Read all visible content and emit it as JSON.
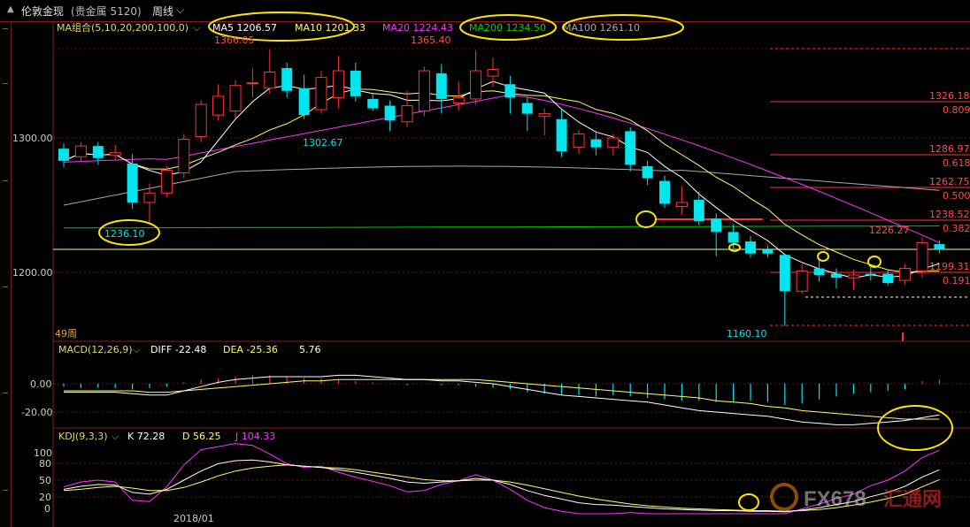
{
  "header": {
    "collapse_glyph": "▲",
    "symbol_name": "伦敦金现",
    "symbol_market": "(贵金属 5120)",
    "period": "周线",
    "dropdown_glyph": "⌵"
  },
  "colors": {
    "up": "#ff3333",
    "down": "#00e5ee",
    "ma5": "#ffffff",
    "ma10": "#ffff66",
    "ma20": "#ff33ff",
    "ma100": "#aaaaaa",
    "ma200": "#00cc00",
    "highlight_ellipse": "#ffe600",
    "grid": "#7a1414",
    "fib_label": "#ff4d4d",
    "last_price_line": "#ffff88"
  },
  "main_panel": {
    "legend_prefix": "MA组合(5,10,20,200,100,0)",
    "ma_legend": [
      {
        "label": "MA5 1206.57",
        "color": "#ffffff"
      },
      {
        "label": "MA10 1201.33",
        "color": "#ffff66"
      },
      {
        "label": "MA20 1224.43",
        "color": "#ff33ff"
      },
      {
        "label": "MA200 1234.50",
        "color": "#00dd00"
      },
      {
        "label": "MA100 1261.10",
        "color": "#aaaaaa"
      }
    ],
    "y_ticks": [
      "1300.00",
      "1200.00"
    ],
    "y_tick_values": [
      1300,
      1200
    ],
    "annotations": {
      "high_1": "1366.05",
      "high_2": "1365.40",
      "mid_low": "1302.67",
      "low_1": "1236.10",
      "low_2": "1160.10",
      "last_high": "1226.27"
    },
    "bars_count_label": "49周",
    "fib_levels": [
      {
        "price": "1326.18",
        "ratio": "0.809"
      },
      {
        "price": "1286.97",
        "ratio": "0.618"
      },
      {
        "price": "1262.75",
        "ratio": "0.500"
      },
      {
        "price": "1238.52",
        "ratio": "0.382"
      },
      {
        "price": "1199.31",
        "ratio": "0.191"
      }
    ]
  },
  "macd_panel": {
    "title": "MACD(12,26,9)",
    "diff": "DIFF -22.48",
    "dea": "DEA -25.36",
    "macd": "5.76",
    "y_ticks": [
      "0.00",
      "-20.00"
    ]
  },
  "kdj_panel": {
    "title": "KDJ(9,3,3)",
    "k": "K 72.28",
    "d": "D 56.25",
    "j": "J 104.33",
    "y_ticks": [
      "100",
      "80",
      "50",
      "20",
      "0"
    ],
    "x_label": "2018/01"
  },
  "watermark": {
    "brand": "FX678",
    "cn": "汇通网"
  },
  "chart_data": {
    "type": "candlestick",
    "period": "weekly",
    "ylim": [
      1160,
      1370
    ],
    "candles": [
      {
        "o": 1292,
        "c": 1283,
        "h": 1296,
        "l": 1278
      },
      {
        "o": 1286,
        "c": 1294,
        "h": 1297,
        "l": 1282
      },
      {
        "o": 1294,
        "c": 1285,
        "h": 1297,
        "l": 1280
      },
      {
        "o": 1287,
        "c": 1289,
        "h": 1295,
        "l": 1283
      },
      {
        "o": 1281,
        "c": 1252,
        "h": 1288,
        "l": 1247
      },
      {
        "o": 1252,
        "c": 1259,
        "h": 1266,
        "l": 1236
      },
      {
        "o": 1259,
        "c": 1276,
        "h": 1279,
        "l": 1256
      },
      {
        "o": 1274,
        "c": 1299,
        "h": 1303,
        "l": 1270
      },
      {
        "o": 1301,
        "c": 1325,
        "h": 1328,
        "l": 1297
      },
      {
        "o": 1317,
        "c": 1331,
        "h": 1340,
        "l": 1313
      },
      {
        "o": 1320,
        "c": 1339,
        "h": 1343,
        "l": 1315
      },
      {
        "o": 1341,
        "c": 1341,
        "h": 1352,
        "l": 1330
      },
      {
        "o": 1337,
        "c": 1349,
        "h": 1366,
        "l": 1333
      },
      {
        "o": 1352,
        "c": 1335,
        "h": 1356,
        "l": 1330
      },
      {
        "o": 1337,
        "c": 1317,
        "h": 1347,
        "l": 1314
      },
      {
        "o": 1321,
        "c": 1345,
        "h": 1350,
        "l": 1318
      },
      {
        "o": 1330,
        "c": 1350,
        "h": 1361,
        "l": 1322
      },
      {
        "o": 1350,
        "c": 1331,
        "h": 1356,
        "l": 1327
      },
      {
        "o": 1329,
        "c": 1322,
        "h": 1333,
        "l": 1320
      },
      {
        "o": 1324,
        "c": 1313,
        "h": 1328,
        "l": 1305
      },
      {
        "o": 1312,
        "c": 1324,
        "h": 1335,
        "l": 1308
      },
      {
        "o": 1320,
        "c": 1350,
        "h": 1353,
        "l": 1316
      },
      {
        "o": 1348,
        "c": 1329,
        "h": 1355,
        "l": 1318
      },
      {
        "o": 1326,
        "c": 1330,
        "h": 1342,
        "l": 1320
      },
      {
        "o": 1329,
        "c": 1350,
        "h": 1365,
        "l": 1325
      },
      {
        "o": 1346,
        "c": 1351,
        "h": 1360,
        "l": 1338
      },
      {
        "o": 1340,
        "c": 1330,
        "h": 1346,
        "l": 1318
      },
      {
        "o": 1326,
        "c": 1318,
        "h": 1330,
        "l": 1305
      },
      {
        "o": 1316,
        "c": 1318,
        "h": 1322,
        "l": 1302
      },
      {
        "o": 1314,
        "c": 1290,
        "h": 1321,
        "l": 1286
      },
      {
        "o": 1293,
        "c": 1303,
        "h": 1306,
        "l": 1288
      },
      {
        "o": 1299,
        "c": 1293,
        "h": 1305,
        "l": 1287
      },
      {
        "o": 1293,
        "c": 1300,
        "h": 1303,
        "l": 1287
      },
      {
        "o": 1305,
        "c": 1280,
        "h": 1308,
        "l": 1275
      },
      {
        "o": 1279,
        "c": 1270,
        "h": 1283,
        "l": 1265
      },
      {
        "o": 1268,
        "c": 1251,
        "h": 1272,
        "l": 1248
      },
      {
        "o": 1249,
        "c": 1252,
        "h": 1264,
        "l": 1243
      },
      {
        "o": 1254,
        "c": 1238,
        "h": 1260,
        "l": 1235
      },
      {
        "o": 1240,
        "c": 1230,
        "h": 1244,
        "l": 1212
      },
      {
        "o": 1230,
        "c": 1222,
        "h": 1236,
        "l": 1218
      },
      {
        "o": 1223,
        "c": 1214,
        "h": 1227,
        "l": 1211
      },
      {
        "o": 1217,
        "c": 1214,
        "h": 1220,
        "l": 1211
      },
      {
        "o": 1213,
        "c": 1186,
        "h": 1214,
        "l": 1160
      },
      {
        "o": 1186,
        "c": 1201,
        "h": 1206,
        "l": 1184
      },
      {
        "o": 1203,
        "c": 1198,
        "h": 1210,
        "l": 1193
      },
      {
        "o": 1199,
        "c": 1196,
        "h": 1203,
        "l": 1188
      },
      {
        "o": 1196,
        "c": 1198,
        "h": 1202,
        "l": 1187
      },
      {
        "o": 1199,
        "c": 1198,
        "h": 1204,
        "l": 1194
      },
      {
        "o": 1199,
        "c": 1192,
        "h": 1202,
        "l": 1190
      },
      {
        "o": 1194,
        "c": 1203,
        "h": 1206,
        "l": 1191
      },
      {
        "o": 1201,
        "c": 1222,
        "h": 1226,
        "l": 1196
      },
      {
        "o": 1221,
        "c": 1217,
        "h": 1224,
        "l": 1214
      }
    ],
    "macd": {
      "ylim": [
        -34,
        12
      ],
      "hist": [
        -2,
        -3,
        -3,
        -3,
        -4,
        -3,
        -2,
        1,
        3,
        4,
        5,
        6,
        6,
        5,
        4,
        4,
        3,
        2,
        1,
        0,
        -1,
        0,
        -1,
        -1,
        -2,
        -3,
        -4,
        -6,
        -7,
        -8,
        -8,
        -9,
        -8,
        -9,
        -10,
        -11,
        -12,
        -12,
        -13,
        -13,
        -12,
        -13,
        -15,
        -14,
        -11,
        -9,
        -7,
        -6,
        -5,
        -4,
        2,
        3
      ],
      "diff": [
        -6,
        -6,
        -6,
        -6,
        -7,
        -8,
        -8,
        -5,
        -2,
        1,
        3,
        4,
        5,
        5,
        5,
        5,
        6,
        6,
        5,
        4,
        3,
        3,
        2,
        2,
        1,
        0,
        -2,
        -4,
        -6,
        -8,
        -9,
        -10,
        -11,
        -12,
        -13,
        -15,
        -17,
        -19,
        -20,
        -21,
        -22,
        -23,
        -25,
        -27,
        -28,
        -29,
        -29,
        -28,
        -27,
        -26,
        -24,
        -22
      ],
      "dea": [
        -5,
        -5,
        -5,
        -5,
        -5,
        -6,
        -6,
        -5,
        -4,
        -3,
        -2,
        -1,
        0,
        1,
        2,
        2,
        3,
        3,
        3,
        3,
        3,
        3,
        3,
        3,
        3,
        2,
        1,
        0,
        -1,
        -2,
        -3,
        -4,
        -5,
        -6,
        -7,
        -8,
        -9,
        -10,
        -12,
        -13,
        -14,
        -16,
        -17,
        -19,
        -20,
        -21,
        -22,
        -23,
        -24,
        -25,
        -25,
        -25
      ]
    },
    "kdj": {
      "ylim": [
        0,
        100
      ],
      "k": [
        40,
        45,
        48,
        47,
        35,
        32,
        40,
        55,
        70,
        82,
        87,
        88,
        85,
        80,
        78,
        76,
        72,
        68,
        63,
        58,
        52,
        50,
        52,
        54,
        58,
        55,
        48,
        38,
        30,
        24,
        18,
        15,
        14,
        12,
        10,
        8,
        7,
        6,
        5,
        5,
        4,
        4,
        3,
        6,
        10,
        15,
        20,
        28,
        35,
        45,
        60,
        72
      ],
      "d": [
        38,
        40,
        43,
        45,
        42,
        38,
        38,
        43,
        52,
        62,
        70,
        75,
        78,
        80,
        78,
        76,
        75,
        72,
        68,
        64,
        60,
        56,
        54,
        54,
        55,
        55,
        52,
        47,
        41,
        35,
        29,
        24,
        20,
        16,
        13,
        11,
        9,
        8,
        7,
        6,
        5,
        5,
        4,
        5,
        7,
        10,
        14,
        19,
        25,
        32,
        44,
        56
      ],
      "j": [
        44,
        52,
        55,
        52,
        22,
        20,
        44,
        80,
        105,
        110,
        115,
        112,
        98,
        82,
        76,
        78,
        68,
        60,
        53,
        46,
        36,
        38,
        48,
        54,
        64,
        55,
        40,
        22,
        10,
        4,
        0,
        0,
        0,
        2,
        0,
        0,
        0,
        0,
        0,
        0,
        0,
        0,
        0,
        8,
        16,
        25,
        32,
        46,
        55,
        70,
        92,
        104
      ]
    }
  }
}
